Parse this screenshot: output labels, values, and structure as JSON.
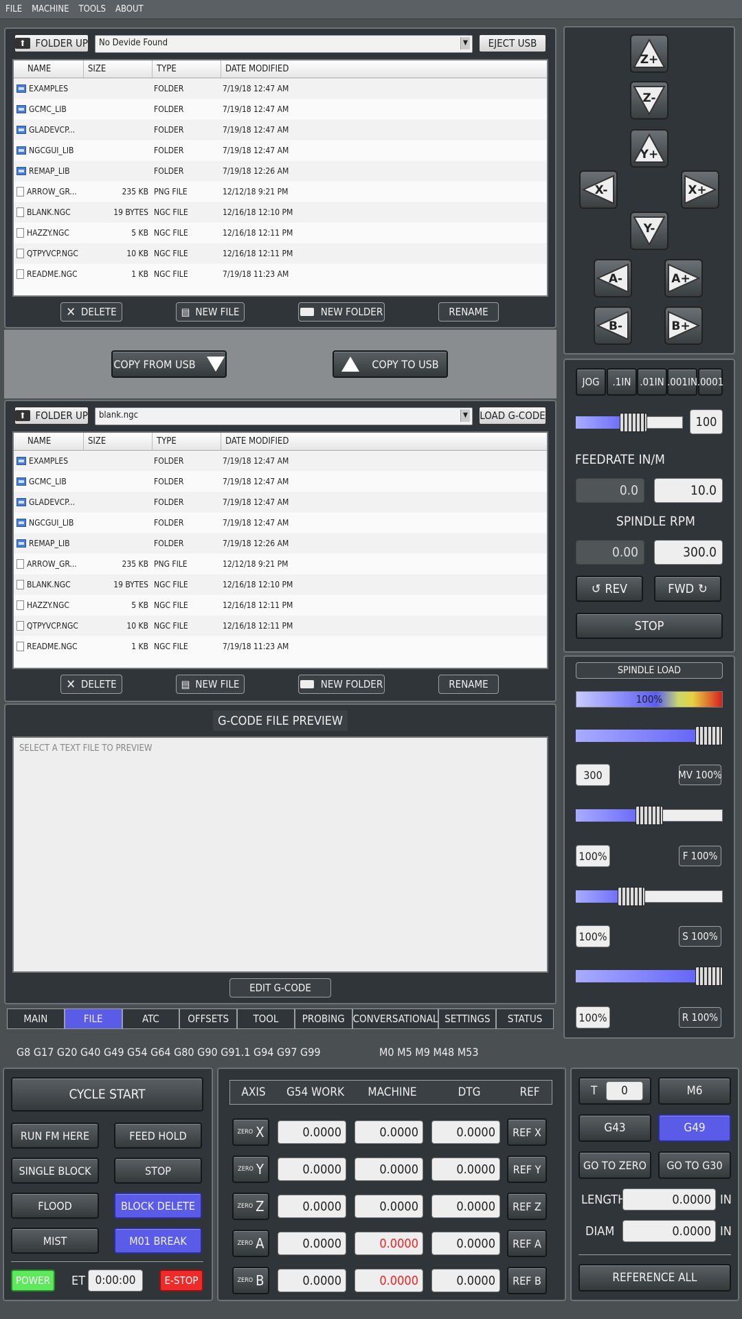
{
  "menu": [
    "FILE",
    "MACHINE",
    "TOOLS",
    "ABOUT"
  ],
  "usb": {
    "folder_up": "FOLDER UP",
    "device": "No Devide Found",
    "eject": "EJECT USB",
    "columns": [
      "NAME",
      "SIZE",
      "TYPE",
      "DATE MODIFIED"
    ],
    "rows": [
      {
        "name": "EXAMPLES",
        "size": "",
        "type": "FOLDER",
        "date": "7/19/18 12:47 AM",
        "kind": "folder"
      },
      {
        "name": "GCMC_LIB",
        "size": "",
        "type": "FOLDER",
        "date": "7/19/18 12:47 AM",
        "kind": "folder"
      },
      {
        "name": "GLADEVCP...",
        "size": "",
        "type": "FOLDER",
        "date": "7/19/18 12:47 AM",
        "kind": "folder"
      },
      {
        "name": "NGCGUI_LIB",
        "size": "",
        "type": "FOLDER",
        "date": "7/19/18 12:47 AM",
        "kind": "folder"
      },
      {
        "name": "REMAP_LIB",
        "size": "",
        "type": "FOLDER",
        "date": "7/19/18 12:26 AM",
        "kind": "folder"
      },
      {
        "name": "ARROW_GR...",
        "size": "235 KB",
        "type": "PNG FILE",
        "date": "12/12/18 9:21 PM",
        "kind": "file"
      },
      {
        "name": "BLANK.NGC",
        "size": "19 BYTES",
        "type": "NGC FILE",
        "date": "12/16/18 12:10 PM",
        "kind": "file"
      },
      {
        "name": "HAZZY.NGC",
        "size": "5 KB",
        "type": "NGC FILE",
        "date": "12/16/18 12:11 PM",
        "kind": "file"
      },
      {
        "name": "QTPYVCP.NGC",
        "size": "10 KB",
        "type": "NGC FILE",
        "date": "12/16/18 12:11 PM",
        "kind": "file"
      },
      {
        "name": "README.NGC",
        "size": "1 KB",
        "type": "NGC FILE",
        "date": "7/19/18 11:23 AM",
        "kind": "file"
      }
    ]
  },
  "file_actions": {
    "delete": "DELETE",
    "new_file": "NEW FILE",
    "new_folder": "NEW FOLDER",
    "rename": "RENAME"
  },
  "copy": {
    "from_usb": "COPY FROM USB",
    "to_usb": "COPY TO USB"
  },
  "local": {
    "folder_up": "FOLDER UP",
    "file": "blank.ngc",
    "load": "LOAD G-CODE"
  },
  "preview": {
    "title": "G-CODE FILE PREVIEW",
    "placeholder": "SELECT A TEXT FILE TO PREVIEW",
    "edit": "EDIT G-CODE"
  },
  "tabs": [
    {
      "label": "MAIN"
    },
    {
      "label": "FILE",
      "active": true
    },
    {
      "label": "ATC"
    },
    {
      "label": "OFFSETS"
    },
    {
      "label": "TOOL"
    },
    {
      "label": "PROBING"
    },
    {
      "label": "CONVERSATIONAL"
    },
    {
      "label": "SETTINGS"
    },
    {
      "label": "STATUS"
    }
  ],
  "gcodes": "G8 G17 G20 G40 G49 G54 G64 G80 G90 G91.1 G94 G97 G99",
  "mcodes": "M0 M5 M9 M48 M53",
  "jog": {
    "z_plus": "Z+",
    "z_minus": "Z-",
    "y_plus": "Y+",
    "y_minus": "Y-",
    "x_minus": "X-",
    "x_plus": "X+",
    "a_minus": "A-",
    "a_plus": "A+",
    "b_minus": "B-",
    "b_plus": "B+"
  },
  "increments": [
    "JOG",
    ".1IN",
    ".01IN",
    ".001IN",
    ".0001"
  ],
  "jog_rate": {
    "value": "100",
    "fraction": 0.55
  },
  "feed": {
    "label": "FEEDRATE IN/M",
    "actual": "0.0",
    "set": "10.0"
  },
  "spindle": {
    "label": "SPINDLE RPM",
    "actual": "0.00",
    "set": "300.0",
    "rev": "REV",
    "fwd": "FWD",
    "stop": "STOP"
  },
  "load": {
    "title": "SPINDLE LOAD",
    "value": "100%",
    "max_vel": {
      "value": "300",
      "btn": "MV 100%",
      "fraction": 1.0
    },
    "feed_ovr": {
      "value": "100%",
      "btn": "F 100%",
      "fraction": 0.5
    },
    "spindle_ovr": {
      "value": "100%",
      "btn": "S 100%",
      "fraction": 0.35
    },
    "rapid_ovr": {
      "value": "100%",
      "btn": "R 100%",
      "fraction": 1.0
    }
  },
  "cycle": {
    "start": "CYCLE START",
    "run_here": "RUN FM HERE",
    "feed_hold": "FEED HOLD",
    "single_block": "SINGLE BLOCK",
    "stop": "STOP",
    "flood": "FLOOD",
    "block_delete": "BLOCK DELETE",
    "mist": "MIST",
    "m01_break": "M01 BREAK",
    "power": "POWER",
    "et_label": "ET",
    "et_value": "0:00:00",
    "estop": "E-STOP"
  },
  "dro": {
    "headers": [
      "AXIS",
      "G54 WORK",
      "MACHINE",
      "DTG",
      "REF"
    ],
    "zero": "ZERO",
    "axes": [
      {
        "axis": "X",
        "work": "0.0000",
        "machine": "0.0000",
        "dtg": "0.0000",
        "ref": "REF X",
        "warn": false
      },
      {
        "axis": "Y",
        "work": "0.0000",
        "machine": "0.0000",
        "dtg": "0.0000",
        "ref": "REF Y",
        "warn": false
      },
      {
        "axis": "Z",
        "work": "0.0000",
        "machine": "0.0000",
        "dtg": "0.0000",
        "ref": "REF Z",
        "warn": false
      },
      {
        "axis": "A",
        "work": "0.0000",
        "machine": "0.0000",
        "dtg": "0.0000",
        "ref": "REF A",
        "warn": true
      },
      {
        "axis": "B",
        "work": "0.0000",
        "machine": "0.0000",
        "dtg": "0.0000",
        "ref": "REF B",
        "warn": true
      }
    ]
  },
  "tool": {
    "t_label": "T",
    "t_value": "0",
    "m6": "M6",
    "g43": "G43",
    "g49": "G49",
    "go_zero": "GO TO ZERO",
    "go_g30": "GO TO G30",
    "length_label": "LENGTH",
    "length": "0.0000",
    "diam_label": "DIAM",
    "diam": "0.0000",
    "unit": "IN",
    "ref_all": "REFERENCE ALL"
  },
  "colors": {
    "accent": "#5a5ce8",
    "power": "#5ee85c",
    "estop": "#ee2b2b",
    "warn": "#ee2222"
  }
}
